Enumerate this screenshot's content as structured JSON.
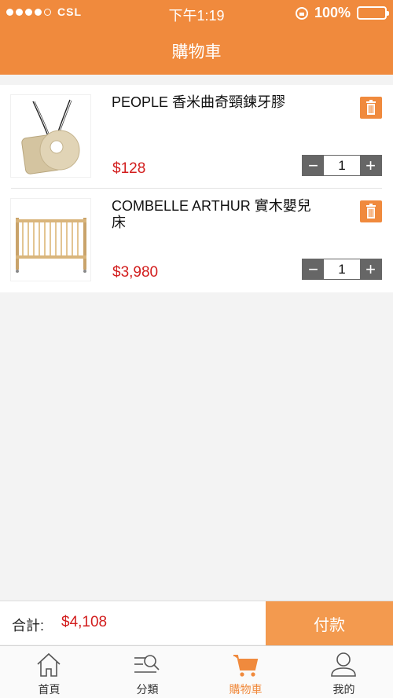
{
  "status_bar": {
    "carrier": "CSL",
    "time": "下午1:19",
    "battery": "100%"
  },
  "header": {
    "title": "購物車"
  },
  "cart": {
    "items": [
      {
        "name": "PEOPLE 香米曲奇頸鍊牙膠",
        "price": "$128",
        "quantity": "1",
        "image": "necklace-teether"
      },
      {
        "name": "COMBELLE ARTHUR 實木嬰兒床",
        "price": "$3,980",
        "quantity": "1",
        "image": "wooden-crib"
      }
    ]
  },
  "checkout": {
    "total_label": "合計:",
    "total_value": "$4,108",
    "pay_label": "付款"
  },
  "tabs": [
    {
      "label": "首頁",
      "icon": "home-icon"
    },
    {
      "label": "分類",
      "icon": "category-search-icon"
    },
    {
      "label": "購物車",
      "icon": "cart-icon",
      "active": true
    },
    {
      "label": "我的",
      "icon": "profile-icon"
    }
  ],
  "colors": {
    "accent": "#f08a3d",
    "price": "#d21d1d",
    "pay_button": "#f39a4f"
  }
}
